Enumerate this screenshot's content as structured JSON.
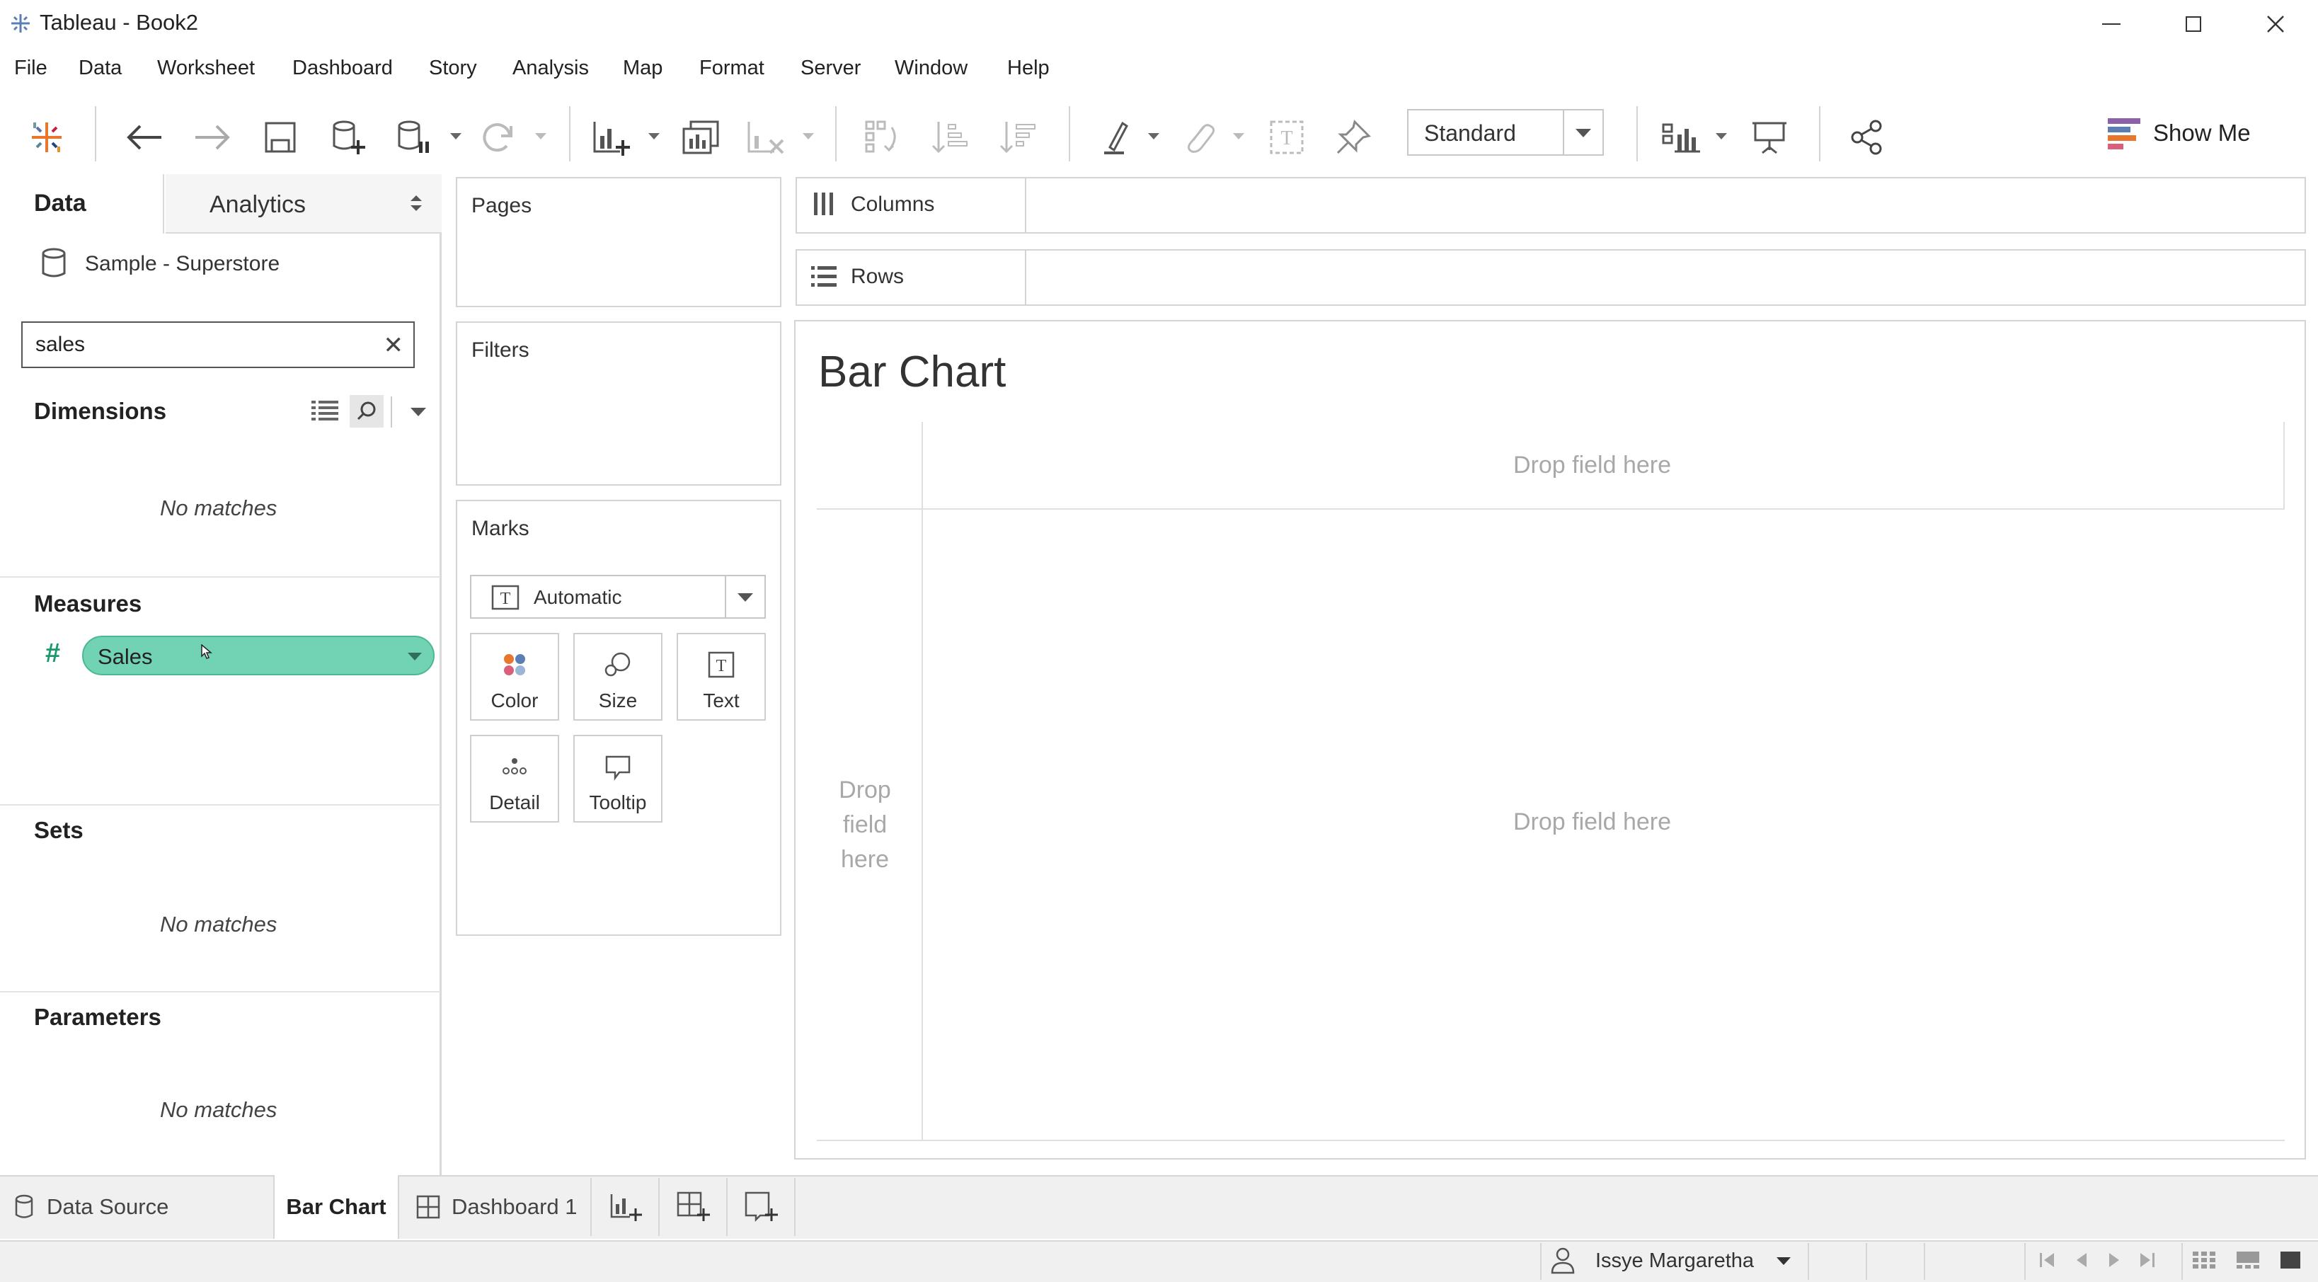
{
  "window": {
    "title": "Tableau - Book2"
  },
  "menu": {
    "items": [
      "File",
      "Data",
      "Worksheet",
      "Dashboard",
      "Story",
      "Analysis",
      "Map",
      "Format",
      "Server",
      "Window",
      "Help"
    ]
  },
  "toolbar": {
    "fit_select": "Standard",
    "show_me_label": "Show Me",
    "icons": [
      "tableau-logo-icon",
      "undo-icon",
      "redo-icon",
      "save-icon",
      "new-data-source-icon",
      "pause-updates-icon",
      "refresh-icon",
      "new-worksheet-icon",
      "duplicate-sheet-icon",
      "clear-sheet-icon",
      "swap-icon",
      "sort-ascending-icon",
      "sort-descending-icon",
      "highlight-icon",
      "group-members-icon",
      "show-mark-labels-icon",
      "fix-axes-icon",
      "show-cards-icon",
      "presentation-mode-icon",
      "share-icon"
    ]
  },
  "data_pane": {
    "tab_data": "Data",
    "tab_analytics": "Analytics",
    "data_source": "Sample - Superstore",
    "search_value": "sales",
    "sections": {
      "dimensions": {
        "title": "Dimensions",
        "empty": "No matches"
      },
      "measures": {
        "title": "Measures",
        "field": "Sales"
      },
      "sets": {
        "title": "Sets",
        "empty": "No matches"
      },
      "parameters": {
        "title": "Parameters",
        "empty": "No matches"
      }
    }
  },
  "cards": {
    "pages": "Pages",
    "filters": "Filters",
    "marks": {
      "title": "Marks",
      "type": "Automatic",
      "buttons": {
        "color": "Color",
        "size": "Size",
        "text": "Text",
        "detail": "Detail",
        "tooltip": "Tooltip"
      }
    }
  },
  "shelves": {
    "columns": "Columns",
    "rows": "Rows"
  },
  "view": {
    "title": "Bar Chart",
    "drop_top": "Drop field here",
    "drop_left": "Drop field here",
    "drop_main": "Drop field here"
  },
  "bottom_tabs": {
    "data_source": "Data Source",
    "active_sheet": "Bar Chart",
    "dashboard": "Dashboard 1"
  },
  "status": {
    "user": "Issye Margaretha"
  },
  "colors": {
    "pill_measure": "#72d3b4",
    "measure_icon": "#1a9a6c"
  }
}
